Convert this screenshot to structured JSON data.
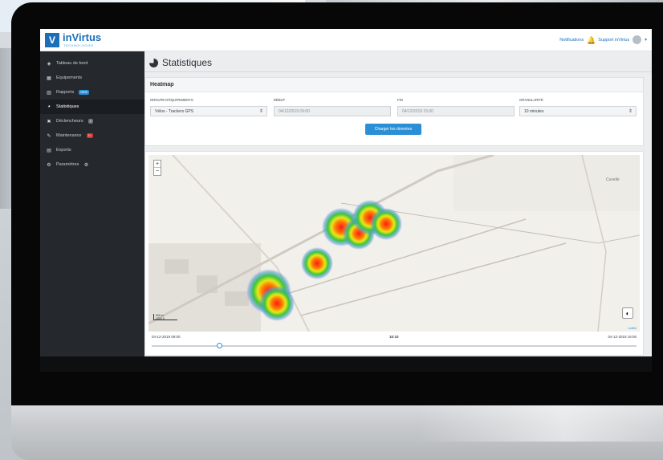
{
  "app": {
    "logo_letter": "V",
    "brand": "inVirtus",
    "brand_sub": "TECHNOLOGIES"
  },
  "topbar": {
    "notifications_label": "Notifications",
    "support_label": "Support inVirtus"
  },
  "sidebar": {
    "items": [
      {
        "label": "Tableau de bord",
        "icon": "dashboard-icon"
      },
      {
        "label": "Equipements",
        "icon": "equipment-icon"
      },
      {
        "label": "Rapports",
        "icon": "chart-bars-icon",
        "badge": "NEW"
      },
      {
        "label": "Statistiques",
        "icon": "pie-chart-icon",
        "active": true
      },
      {
        "label": "Déclencheurs",
        "icon": "trigger-icon",
        "badge": "4"
      },
      {
        "label": "Maintenance",
        "icon": "wrench-icon",
        "badge": "10"
      },
      {
        "label": "Exports",
        "icon": "export-icon"
      },
      {
        "label": "Paramètres",
        "icon": "gear-icon"
      }
    ]
  },
  "page": {
    "title": "Statistiques"
  },
  "heatmap_panel": {
    "title": "Heatmap",
    "group_label": "GROUPE D'ÉQUIPEMENTS",
    "group_value": "Vélos - Trackers GPS",
    "start_label": "DÉBUT",
    "start_value": "04/12/2019 09:00",
    "end_label": "FIN",
    "end_value": "04/12/2019 15:00",
    "granularity_label": "GRANULARITÉ",
    "granularity_value": "10 minutes",
    "load_button": "Charger les données"
  },
  "map": {
    "zoom_in": "+",
    "zoom_out": "−",
    "scale_label_1": "500 m",
    "scale_label_2": "1000 ft",
    "attribution": "Leaflet",
    "place_label": "Cuvelle"
  },
  "timeline": {
    "start": "04-12-2019 09:00",
    "current": "10:10",
    "end": "04-12-2019 16:00",
    "position": 0.14
  },
  "colors": {
    "accent": "#2b8fd6",
    "sidebar_bg": "#25292e",
    "brand": "#1b6fb8"
  }
}
